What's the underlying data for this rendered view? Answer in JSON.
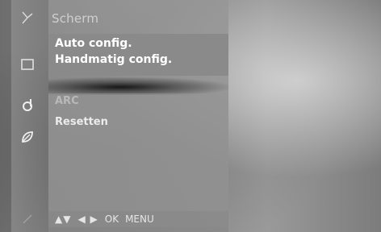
{
  "menu": {
    "title": "Scherm",
    "submenu": [
      {
        "label": "Auto config."
      },
      {
        "label": "Handmatig config."
      }
    ],
    "items": [
      {
        "label": "ARC"
      },
      {
        "label": "Resetten"
      }
    ]
  },
  "footer": {
    "updown": "▲▼",
    "leftright": "◀ ▶",
    "ok": "OK",
    "menu": "MENU"
  },
  "icons": [
    "antenna-icon",
    "screen-icon",
    "sound-icon",
    "leaf-icon",
    "lock-icon"
  ],
  "colors": {
    "panel": "#8a8a8a",
    "text": "#ffffff",
    "muted": "#b9b9b9"
  }
}
